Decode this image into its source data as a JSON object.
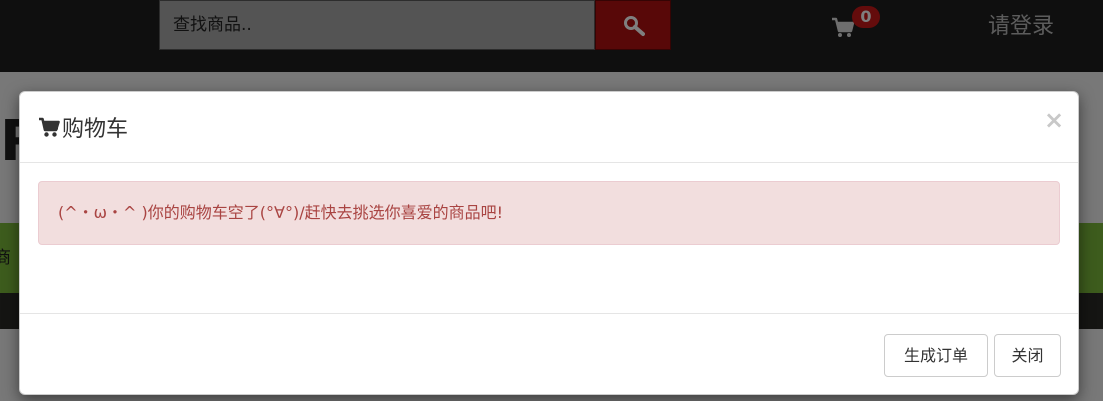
{
  "header": {
    "search_placeholder": "查找商品..",
    "cart_count": "0",
    "login_label": "请登录"
  },
  "background": {
    "heading_fragment": "R",
    "nav_fragment": "商品"
  },
  "modal": {
    "title": "购物车",
    "close_symbol": "×",
    "empty_message": "(^・ω・^ )你的购物车空了(°∀°)/赶快去挑选你喜爱的商品吧!",
    "generate_order_label": "生成订单",
    "close_label": "关闭"
  },
  "colors": {
    "topbar": "#1e1e1e",
    "search_button": "#b01010",
    "badge": "#c81818",
    "alert_bg": "#f2dede",
    "alert_text": "#a94442",
    "green_band": "#7ab83a"
  },
  "icons": {
    "search": "search-icon",
    "cart": "shopping-cart-icon",
    "close": "close-icon"
  }
}
